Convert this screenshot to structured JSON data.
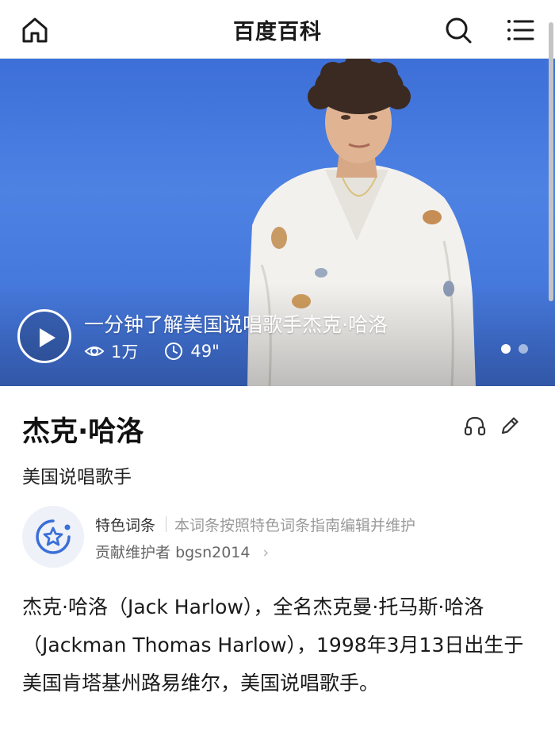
{
  "header": {
    "title": "百度百科",
    "home_icon": "home-icon",
    "search_icon": "search-icon",
    "menu_icon": "menu-icon"
  },
  "video": {
    "title": "一分钟了解美国说唱歌手杰克·哈洛",
    "views": "1万",
    "duration": "49\"",
    "play_icon": "play-icon",
    "views_icon": "eye-icon",
    "duration_icon": "clock-icon",
    "carousel_pages": 2,
    "carousel_active": 1
  },
  "entry": {
    "title": "杰克·哈洛",
    "subtitle": "美国说唱歌手",
    "listen_icon": "headphones-icon",
    "edit_icon": "pencil-icon"
  },
  "featured": {
    "label": "特色词条",
    "description": "本词条按照特色词条指南编辑并维护",
    "contributor_label": "贡献维护者",
    "contributor_name": "bgsn2014",
    "badge_icon": "star-badge-icon",
    "chevron": "›"
  },
  "summary": {
    "text": "杰克·哈洛（Jack Harlow），全名杰克曼·托马斯·哈洛（Jackman Thomas Harlow），1998年3月13日出生于美国肯塔基州路易维尔，美国说唱歌手。"
  },
  "colors": {
    "hero_blue": "#4d82e3",
    "accent_blue": "#3a6fd8",
    "text_dark": "#1a1a1a",
    "text_muted": "#9a9a9a"
  }
}
